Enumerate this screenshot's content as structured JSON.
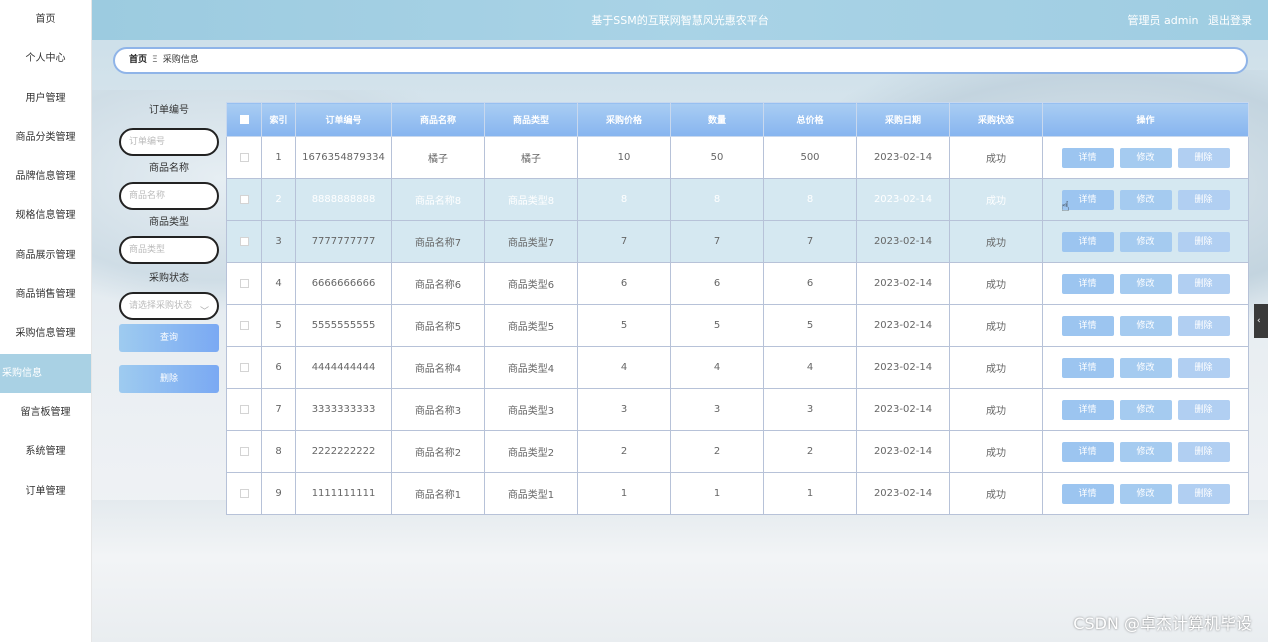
{
  "header": {
    "title": "基于SSM的互联网智慧风光惠农平台",
    "user_label": "管理员 admin",
    "logout_label": "退出登录"
  },
  "sidebar": {
    "items": [
      {
        "label": "首页"
      },
      {
        "label": "个人中心"
      },
      {
        "label": "用户管理"
      },
      {
        "label": "商品分类管理"
      },
      {
        "label": "品牌信息管理"
      },
      {
        "label": "规格信息管理"
      },
      {
        "label": "商品展示管理"
      },
      {
        "label": "商品销售管理"
      },
      {
        "label": "采购信息管理"
      },
      {
        "label": "采购信息",
        "active": true
      },
      {
        "label": "留言板管理"
      },
      {
        "label": "系统管理"
      },
      {
        "label": "订单管理"
      }
    ]
  },
  "breadcrumb": {
    "home": "首页",
    "separator": "Ξ",
    "current": "采购信息"
  },
  "search": {
    "order_no_label": "订单编号",
    "order_no_placeholder": "订单编号",
    "name_label": "商品名称",
    "name_placeholder": "商品名称",
    "type_label": "商品类型",
    "type_placeholder": "商品类型",
    "status_label": "采购状态",
    "status_placeholder": "请选择采购状态",
    "query_button": "查询",
    "delete_button": "删除"
  },
  "table": {
    "headers": [
      "索引",
      "订单编号",
      "商品名称",
      "商品类型",
      "采购价格",
      "数量",
      "总价格",
      "采购日期",
      "采购状态",
      "操作"
    ],
    "actions": {
      "detail": "详情",
      "edit": "修改",
      "delete": "删除"
    },
    "rows": [
      {
        "idx": "1",
        "order_no": "1676354879334",
        "name": "橘子",
        "type": "橘子",
        "price": "10",
        "qty": "50",
        "total": "500",
        "date": "2023-02-14",
        "status": "成功"
      },
      {
        "idx": "2",
        "order_no": "8888888888",
        "name": "商品名称8",
        "type": "商品类型8",
        "price": "8",
        "qty": "8",
        "total": "8",
        "date": "2023-02-14",
        "status": "成功"
      },
      {
        "idx": "3",
        "order_no": "7777777777",
        "name": "商品名称7",
        "type": "商品类型7",
        "price": "7",
        "qty": "7",
        "total": "7",
        "date": "2023-02-14",
        "status": "成功"
      },
      {
        "idx": "4",
        "order_no": "6666666666",
        "name": "商品名称6",
        "type": "商品类型6",
        "price": "6",
        "qty": "6",
        "total": "6",
        "date": "2023-02-14",
        "status": "成功"
      },
      {
        "idx": "5",
        "order_no": "5555555555",
        "name": "商品名称5",
        "type": "商品类型5",
        "price": "5",
        "qty": "5",
        "total": "5",
        "date": "2023-02-14",
        "status": "成功"
      },
      {
        "idx": "6",
        "order_no": "4444444444",
        "name": "商品名称4",
        "type": "商品类型4",
        "price": "4",
        "qty": "4",
        "total": "4",
        "date": "2023-02-14",
        "status": "成功"
      },
      {
        "idx": "7",
        "order_no": "3333333333",
        "name": "商品名称3",
        "type": "商品类型3",
        "price": "3",
        "qty": "3",
        "total": "3",
        "date": "2023-02-14",
        "status": "成功"
      },
      {
        "idx": "8",
        "order_no": "2222222222",
        "name": "商品名称2",
        "type": "商品类型2",
        "price": "2",
        "qty": "2",
        "total": "2",
        "date": "2023-02-14",
        "status": "成功"
      },
      {
        "idx": "9",
        "order_no": "1111111111",
        "name": "商品名称1",
        "type": "商品类型1",
        "price": "1",
        "qty": "1",
        "total": "1",
        "date": "2023-02-14",
        "status": "成功"
      }
    ]
  },
  "watermark": "CSDN @卓杰计算机毕设",
  "colors": {
    "header_bg": "#a9d3e6",
    "table_header": "#86b4ef",
    "highlight_row": "#d5e8f1",
    "button": "#9cc5f0"
  }
}
